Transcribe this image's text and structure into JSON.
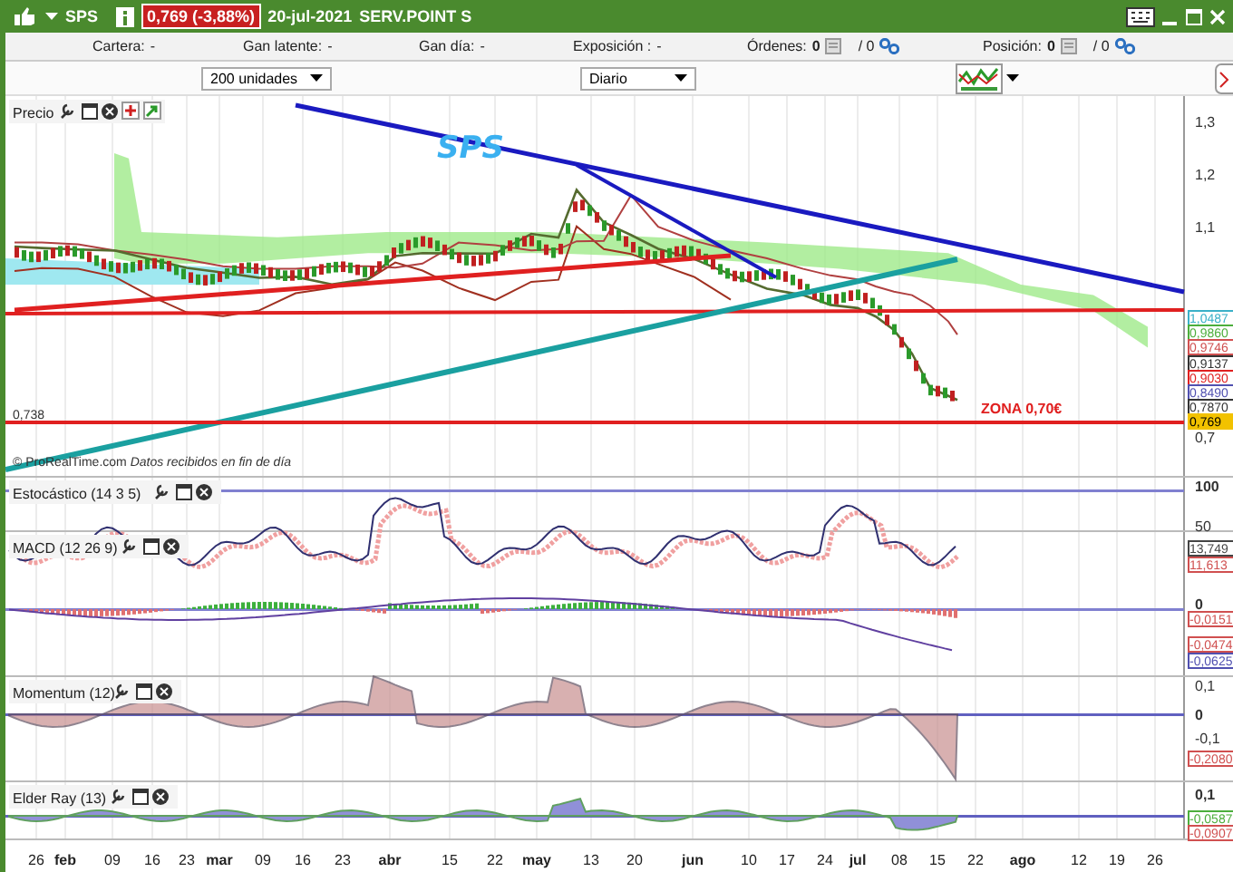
{
  "title_bar": {
    "symbol": "SPS",
    "quote": "0,769 (-3,88%)",
    "date": "20-jul-2021",
    "name": "SERV.POINT S"
  },
  "info_bar": [
    {
      "kind": "plain",
      "label": "Cartera:",
      "value": "-"
    },
    {
      "kind": "plain",
      "label": "Gan latente:",
      "value": "-"
    },
    {
      "kind": "plain",
      "label": "Gan día:",
      "value": "-"
    },
    {
      "kind": "plain",
      "label": "Exposición :",
      "value": "-"
    },
    {
      "kind": "count",
      "label": "Órdenes:",
      "value": "0",
      "total": "/ 0"
    },
    {
      "kind": "count",
      "label": "Posición:",
      "value": "0",
      "total": "/ 0"
    }
  ],
  "toolbar": {
    "quantity": "200 unidades",
    "period": "Diario"
  },
  "chart": {
    "annotation": "SPS",
    "zone_label": "ZONA 0,70€",
    "support_label": "0,738",
    "copyright": "© ProRealTime.com",
    "notice": "Datos recibidos en fin de día",
    "panels": [
      {
        "kind": "price",
        "title": "Precio",
        "ticks": [
          "1,3",
          "1,2",
          "1,1",
          "0,7"
        ]
      },
      {
        "kind": "stochastic",
        "title": "Estocástico (14 3 5)",
        "ticks": [
          "100",
          "50"
        ]
      },
      {
        "kind": "macd",
        "title": "MACD (12 26 9)",
        "ticks": [
          "0"
        ]
      },
      {
        "kind": "momentum",
        "title": "Momentum (12)",
        "ticks": [
          "0,1",
          "0",
          "-0,1"
        ]
      },
      {
        "kind": "elder",
        "title": "Elder Ray (13)",
        "ticks": [
          "0,1"
        ]
      }
    ],
    "value_tags": [
      {
        "text": "1,0487",
        "color": "#3ab0c8"
      },
      {
        "text": "0,9860",
        "color": "#4cae3c"
      },
      {
        "text": "0,9746",
        "color": "#d05050"
      },
      {
        "text": "0,9137",
        "color": "#333333"
      },
      {
        "text": "0,9030",
        "color": "#e02020"
      },
      {
        "text": "0,8490",
        "color": "#5050b0"
      },
      {
        "text": "0,7870",
        "color": "#333333"
      },
      {
        "text": "0,769",
        "color": "#f2c200"
      },
      {
        "text": "13,749",
        "color": "#444444"
      },
      {
        "text": "11,613",
        "color": "#d05050"
      },
      {
        "text": "-0,0151",
        "color": "#d05050"
      },
      {
        "text": "-0,0474",
        "color": "#d05050"
      },
      {
        "text": "-0,0625",
        "color": "#5050b0"
      },
      {
        "text": "-0,2080",
        "color": "#d05050"
      },
      {
        "text": "-0,0587",
        "color": "#4cae3c"
      },
      {
        "text": "-0,0907",
        "color": "#d05050"
      }
    ],
    "x_labels": [
      {
        "text": "26",
        "month": false
      },
      {
        "text": "feb",
        "month": true
      },
      {
        "text": "09",
        "month": false
      },
      {
        "text": "16",
        "month": false
      },
      {
        "text": "23",
        "month": false
      },
      {
        "text": "mar",
        "month": true
      },
      {
        "text": "09",
        "month": false
      },
      {
        "text": "16",
        "month": false
      },
      {
        "text": "23",
        "month": false
      },
      {
        "text": "abr",
        "month": true
      },
      {
        "text": "15",
        "month": false
      },
      {
        "text": "22",
        "month": false
      },
      {
        "text": "may",
        "month": true
      },
      {
        "text": "13",
        "month": false
      },
      {
        "text": "20",
        "month": false
      },
      {
        "text": "jun",
        "month": true
      },
      {
        "text": "10",
        "month": false
      },
      {
        "text": "17",
        "month": false
      },
      {
        "text": "24",
        "month": false
      },
      {
        "text": "jul",
        "month": true
      },
      {
        "text": "08",
        "month": false
      },
      {
        "text": "15",
        "month": false
      },
      {
        "text": "22",
        "month": false
      },
      {
        "text": "ago",
        "month": true
      },
      {
        "text": "12",
        "month": false
      },
      {
        "text": "19",
        "month": false
      },
      {
        "text": "26",
        "month": false
      }
    ]
  }
}
